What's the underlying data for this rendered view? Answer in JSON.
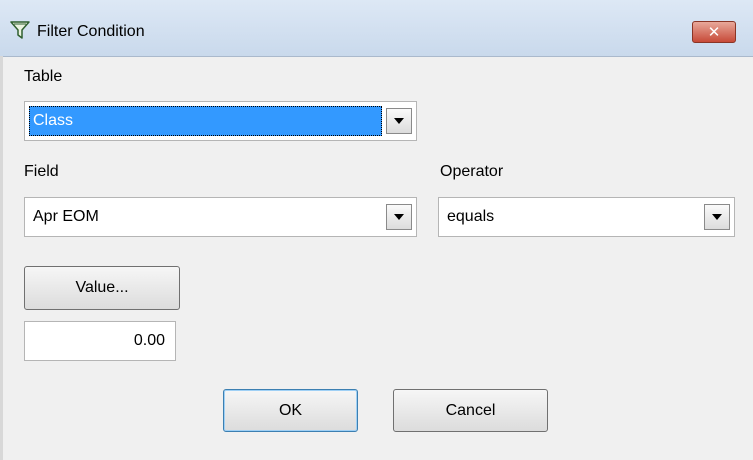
{
  "window": {
    "title": "Filter Condition",
    "icon": "filter-funnel-icon",
    "close_symbol": "✕"
  },
  "table": {
    "label": "Table",
    "selected": "Class"
  },
  "field": {
    "label": "Field",
    "selected": "Apr EOM"
  },
  "operator": {
    "label": "Operator",
    "selected": "equals"
  },
  "value": {
    "button_label": "Value...",
    "input_value": "0.00"
  },
  "buttons": {
    "ok_label": "OK",
    "cancel_label": "Cancel"
  },
  "colors": {
    "selection": "#3399ff",
    "close_button": "#c74a38",
    "default_button_border": "#3c7fb1"
  }
}
